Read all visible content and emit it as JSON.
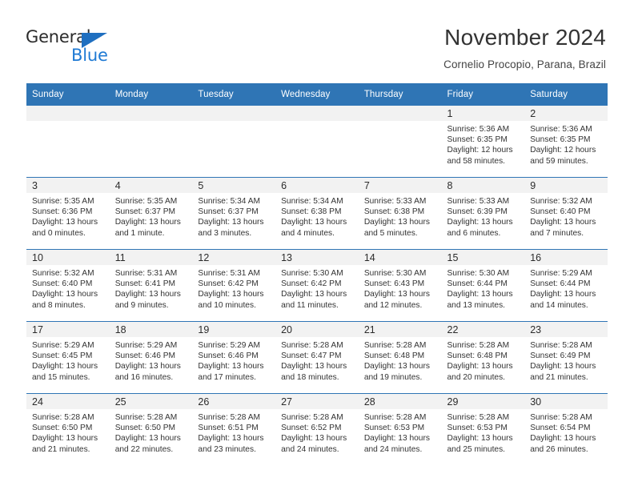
{
  "branding": {
    "logo_text_primary": "General",
    "logo_text_secondary": "Blue",
    "logo_primary_color": "#2b2b2b",
    "logo_secondary_color": "#1f7ad4",
    "logo_triangle_color": "#1f6fc0"
  },
  "header": {
    "month_title": "November 2024",
    "location": "Cornelio Procopio, Parana, Brazil"
  },
  "theme": {
    "header_blue": "#2f75b5",
    "daynum_band_gray": "#f2f2f2",
    "page_background": "#ffffff",
    "body_text": "#333333"
  },
  "calendar": {
    "weekday_headers": [
      "Sunday",
      "Monday",
      "Tuesday",
      "Wednesday",
      "Thursday",
      "Friday",
      "Saturday"
    ],
    "weeks": [
      [
        {
          "day": "",
          "lines": []
        },
        {
          "day": "",
          "lines": []
        },
        {
          "day": "",
          "lines": []
        },
        {
          "day": "",
          "lines": []
        },
        {
          "day": "",
          "lines": []
        },
        {
          "day": "1",
          "lines": [
            "Sunrise: 5:36 AM",
            "Sunset: 6:35 PM",
            "Daylight: 12 hours",
            "and 58 minutes."
          ]
        },
        {
          "day": "2",
          "lines": [
            "Sunrise: 5:36 AM",
            "Sunset: 6:35 PM",
            "Daylight: 12 hours",
            "and 59 minutes."
          ]
        }
      ],
      [
        {
          "day": "3",
          "lines": [
            "Sunrise: 5:35 AM",
            "Sunset: 6:36 PM",
            "Daylight: 13 hours",
            "and 0 minutes."
          ]
        },
        {
          "day": "4",
          "lines": [
            "Sunrise: 5:35 AM",
            "Sunset: 6:37 PM",
            "Daylight: 13 hours",
            "and 1 minute."
          ]
        },
        {
          "day": "5",
          "lines": [
            "Sunrise: 5:34 AM",
            "Sunset: 6:37 PM",
            "Daylight: 13 hours",
            "and 3 minutes."
          ]
        },
        {
          "day": "6",
          "lines": [
            "Sunrise: 5:34 AM",
            "Sunset: 6:38 PM",
            "Daylight: 13 hours",
            "and 4 minutes."
          ]
        },
        {
          "day": "7",
          "lines": [
            "Sunrise: 5:33 AM",
            "Sunset: 6:38 PM",
            "Daylight: 13 hours",
            "and 5 minutes."
          ]
        },
        {
          "day": "8",
          "lines": [
            "Sunrise: 5:33 AM",
            "Sunset: 6:39 PM",
            "Daylight: 13 hours",
            "and 6 minutes."
          ]
        },
        {
          "day": "9",
          "lines": [
            "Sunrise: 5:32 AM",
            "Sunset: 6:40 PM",
            "Daylight: 13 hours",
            "and 7 minutes."
          ]
        }
      ],
      [
        {
          "day": "10",
          "lines": [
            "Sunrise: 5:32 AM",
            "Sunset: 6:40 PM",
            "Daylight: 13 hours",
            "and 8 minutes."
          ]
        },
        {
          "day": "11",
          "lines": [
            "Sunrise: 5:31 AM",
            "Sunset: 6:41 PM",
            "Daylight: 13 hours",
            "and 9 minutes."
          ]
        },
        {
          "day": "12",
          "lines": [
            "Sunrise: 5:31 AM",
            "Sunset: 6:42 PM",
            "Daylight: 13 hours",
            "and 10 minutes."
          ]
        },
        {
          "day": "13",
          "lines": [
            "Sunrise: 5:30 AM",
            "Sunset: 6:42 PM",
            "Daylight: 13 hours",
            "and 11 minutes."
          ]
        },
        {
          "day": "14",
          "lines": [
            "Sunrise: 5:30 AM",
            "Sunset: 6:43 PM",
            "Daylight: 13 hours",
            "and 12 minutes."
          ]
        },
        {
          "day": "15",
          "lines": [
            "Sunrise: 5:30 AM",
            "Sunset: 6:44 PM",
            "Daylight: 13 hours",
            "and 13 minutes."
          ]
        },
        {
          "day": "16",
          "lines": [
            "Sunrise: 5:29 AM",
            "Sunset: 6:44 PM",
            "Daylight: 13 hours",
            "and 14 minutes."
          ]
        }
      ],
      [
        {
          "day": "17",
          "lines": [
            "Sunrise: 5:29 AM",
            "Sunset: 6:45 PM",
            "Daylight: 13 hours",
            "and 15 minutes."
          ]
        },
        {
          "day": "18",
          "lines": [
            "Sunrise: 5:29 AM",
            "Sunset: 6:46 PM",
            "Daylight: 13 hours",
            "and 16 minutes."
          ]
        },
        {
          "day": "19",
          "lines": [
            "Sunrise: 5:29 AM",
            "Sunset: 6:46 PM",
            "Daylight: 13 hours",
            "and 17 minutes."
          ]
        },
        {
          "day": "20",
          "lines": [
            "Sunrise: 5:28 AM",
            "Sunset: 6:47 PM",
            "Daylight: 13 hours",
            "and 18 minutes."
          ]
        },
        {
          "day": "21",
          "lines": [
            "Sunrise: 5:28 AM",
            "Sunset: 6:48 PM",
            "Daylight: 13 hours",
            "and 19 minutes."
          ]
        },
        {
          "day": "22",
          "lines": [
            "Sunrise: 5:28 AM",
            "Sunset: 6:48 PM",
            "Daylight: 13 hours",
            "and 20 minutes."
          ]
        },
        {
          "day": "23",
          "lines": [
            "Sunrise: 5:28 AM",
            "Sunset: 6:49 PM",
            "Daylight: 13 hours",
            "and 21 minutes."
          ]
        }
      ],
      [
        {
          "day": "24",
          "lines": [
            "Sunrise: 5:28 AM",
            "Sunset: 6:50 PM",
            "Daylight: 13 hours",
            "and 21 minutes."
          ]
        },
        {
          "day": "25",
          "lines": [
            "Sunrise: 5:28 AM",
            "Sunset: 6:50 PM",
            "Daylight: 13 hours",
            "and 22 minutes."
          ]
        },
        {
          "day": "26",
          "lines": [
            "Sunrise: 5:28 AM",
            "Sunset: 6:51 PM",
            "Daylight: 13 hours",
            "and 23 minutes."
          ]
        },
        {
          "day": "27",
          "lines": [
            "Sunrise: 5:28 AM",
            "Sunset: 6:52 PM",
            "Daylight: 13 hours",
            "and 24 minutes."
          ]
        },
        {
          "day": "28",
          "lines": [
            "Sunrise: 5:28 AM",
            "Sunset: 6:53 PM",
            "Daylight: 13 hours",
            "and 24 minutes."
          ]
        },
        {
          "day": "29",
          "lines": [
            "Sunrise: 5:28 AM",
            "Sunset: 6:53 PM",
            "Daylight: 13 hours",
            "and 25 minutes."
          ]
        },
        {
          "day": "30",
          "lines": [
            "Sunrise: 5:28 AM",
            "Sunset: 6:54 PM",
            "Daylight: 13 hours",
            "and 26 minutes."
          ]
        }
      ]
    ]
  }
}
